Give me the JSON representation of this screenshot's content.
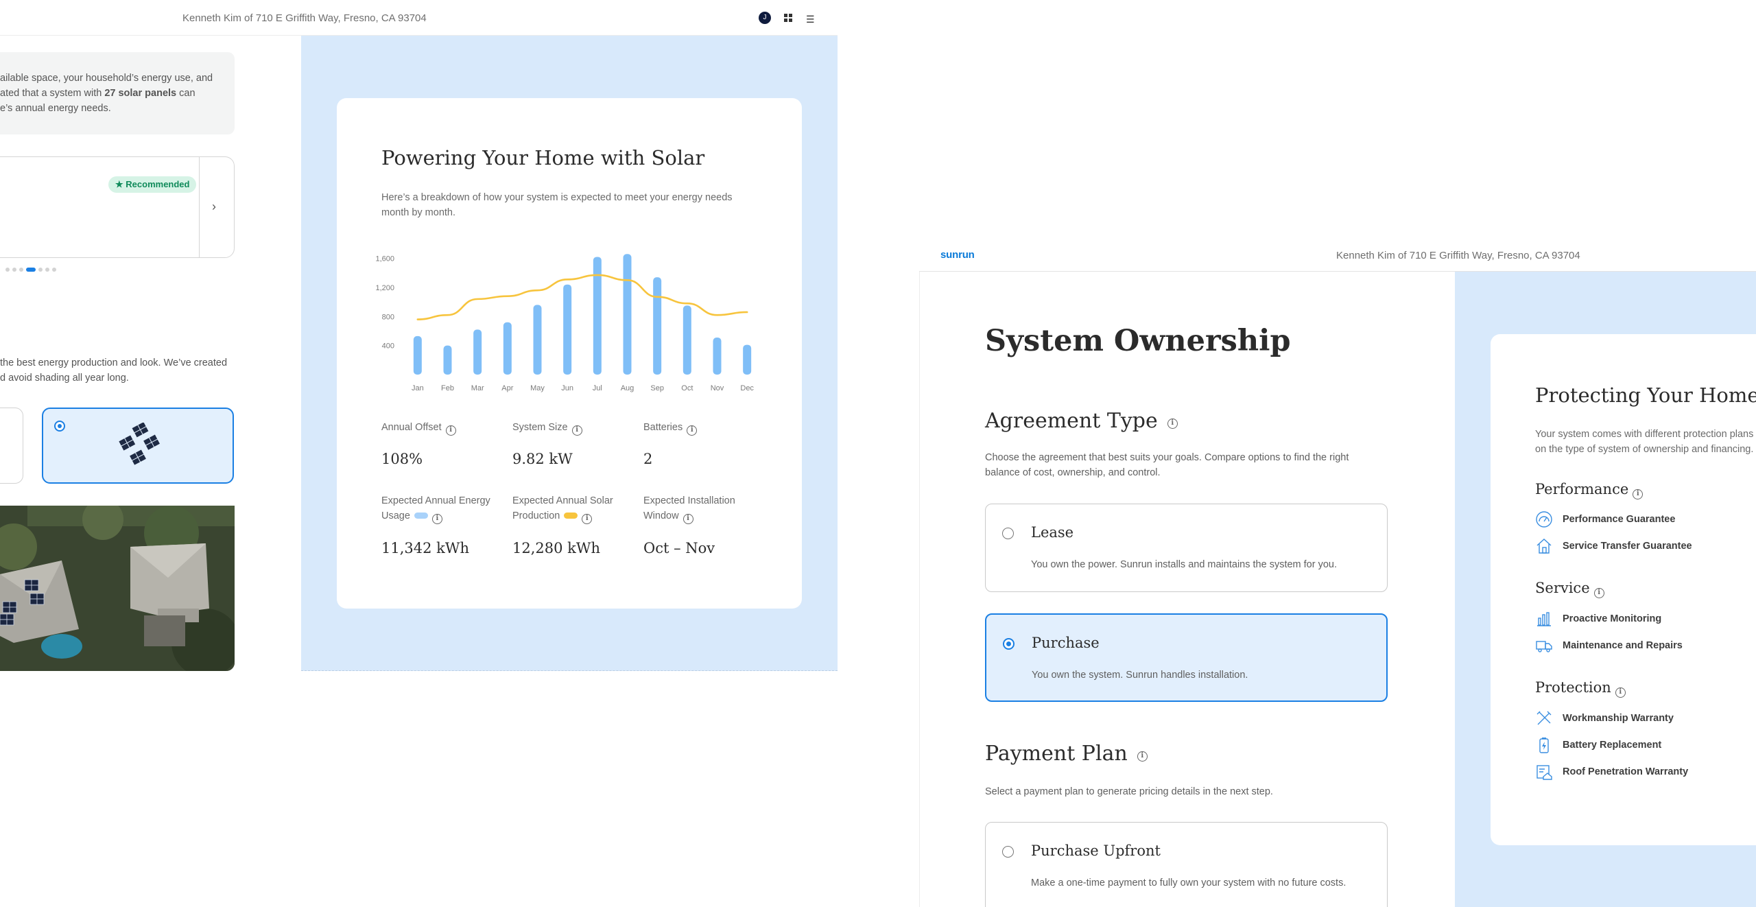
{
  "left_screen": {
    "header": {
      "address": "Kenneth Kim of 710 E Griffith Way, Fresno, CA 93704",
      "avatar_initial": "J"
    },
    "summary": {
      "line1": "ailable space, your household’s energy use, and",
      "line2_pre": "ated that a system with ",
      "line2_bold": "27 solar panels",
      "line2_post": " can",
      "line3": "e’s annual energy needs."
    },
    "recommended_badge": "Recommended",
    "design_text": {
      "line1": "the best energy production and look. We’ve created",
      "line2": "d avoid shading all year long."
    },
    "solar_card": {
      "title": "Powering Your Home with Solar",
      "subtitle": "Here’s a breakdown of how your system is expected to meet your energy needs month by month.",
      "stats": {
        "annual_offset_label": "Annual Offset",
        "annual_offset_value": "108%",
        "system_size_label": "System Size",
        "system_size_value": "9.82 kW",
        "batteries_label": "Batteries",
        "batteries_value": "2",
        "usage_label_1": "Expected Annual Energy",
        "usage_label_2": "Usage",
        "usage_value": "11,342 kWh",
        "production_label_1": "Expected Annual Solar",
        "production_label_2": "Production",
        "production_value": "12,280 kWh",
        "install_label_1": "Expected Installation",
        "install_label_2": "Window",
        "install_value": "Oct – Nov"
      }
    }
  },
  "chart_data": {
    "type": "bar",
    "categories": [
      "Jan",
      "Feb",
      "Mar",
      "Apr",
      "May",
      "Jun",
      "Jul",
      "Aug",
      "Sep",
      "Oct",
      "Nov",
      "Dec"
    ],
    "series": [
      {
        "values": [
          530,
          400,
          620,
          720,
          960,
          1240,
          1620,
          1660,
          1340,
          950,
          510,
          410
        ],
        "color": "#7fbef7"
      },
      {
        "values": [
          760,
          820,
          1040,
          1080,
          1160,
          1310,
          1370,
          1300,
          1070,
          980,
          820,
          860
        ],
        "color": "#f7c43d"
      }
    ],
    "yticks": [
      400,
      800,
      1200,
      1600
    ],
    "ytick_labels": [
      "400",
      "800",
      "1,200",
      "1,600"
    ],
    "ylim": [
      0,
      1700
    ],
    "title": "",
    "xlabel": "",
    "ylabel": "",
    "grid": false
  },
  "right_screen": {
    "header": {
      "logo": "sunrun",
      "address": "Kenneth Kim of 710 E Griffith Way, Fresno, CA 93704"
    },
    "page_title": "System Ownership",
    "agreement": {
      "heading": "Agreement Type",
      "description": "Choose the agreement that best suits your goals. Compare options to find the right balance of cost, ownership, and control.",
      "options": [
        {
          "title": "Lease",
          "desc": "You own the power. Sunrun installs and maintains the system for you.",
          "selected": false
        },
        {
          "title": "Purchase",
          "desc": "You own the system. Sunrun handles installation.",
          "selected": true
        }
      ]
    },
    "payment": {
      "heading": "Payment Plan",
      "description": "Select a payment plan to generate pricing details in the next step.",
      "options": [
        {
          "title": "Purchase Upfront",
          "desc": "Make a one-time payment to fully own your system with no future costs.",
          "selected": false
        }
      ]
    },
    "protection_card": {
      "title": "Protecting Your Home E",
      "sub1": "Your system comes with different protection plans",
      "sub2": "on the type of system of ownership and financing.",
      "groups": [
        {
          "name": "Performance",
          "items": [
            {
              "label": "Performance Guarantee",
              "icon": "gauge-icon"
            },
            {
              "label": "Service Transfer Guarantee",
              "icon": "house-icon"
            }
          ]
        },
        {
          "name": "Service",
          "items": [
            {
              "label": "Proactive Monitoring",
              "icon": "monitoring-icon"
            },
            {
              "label": "Maintenance and Repairs",
              "icon": "truck-icon"
            }
          ]
        },
        {
          "name": "Protection",
          "items": [
            {
              "label": "Workmanship Warranty",
              "icon": "tools-icon"
            },
            {
              "label": "Battery Replacement",
              "icon": "battery-icon"
            },
            {
              "label": "Roof Penetration Warranty",
              "icon": "roof-doc-icon"
            }
          ]
        }
      ]
    }
  },
  "colors": {
    "accent": "#1a7fe3",
    "panel_bg": "#d8e9fb",
    "bar": "#7fbef7",
    "line": "#f7c43d",
    "badge_green": "#0f8a5a"
  }
}
